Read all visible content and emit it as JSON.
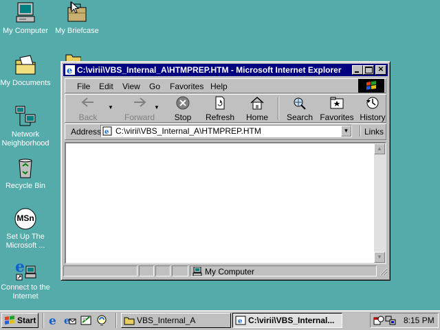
{
  "desktop": {
    "icons": [
      {
        "label_line1": "My Computer",
        "label_line2": ""
      },
      {
        "label_line1": "My Briefcase",
        "label_line2": ""
      },
      {
        "label_line1": "My Documents",
        "label_line2": ""
      },
      {
        "label_line1": "Network",
        "label_line2": "Neighborhood"
      },
      {
        "label_line1": "Recycle Bin",
        "label_line2": ""
      },
      {
        "label_line1": "Set Up The",
        "label_line2": "Microsoft ..."
      },
      {
        "label_line1": "Connect to the",
        "label_line2": "Internet"
      }
    ],
    "msn_text": "MSn"
  },
  "window": {
    "title": "C:\\virii\\VBS_Internal_A\\HTMPREP.HTM - Microsoft Internet Explorer",
    "menu": [
      "File",
      "Edit",
      "View",
      "Go",
      "Favorites",
      "Help"
    ],
    "toolbar": {
      "back": "Back",
      "forward": "Forward",
      "stop": "Stop",
      "refresh": "Refresh",
      "home": "Home",
      "search": "Search",
      "favorites": "Favorites",
      "history": "History"
    },
    "address_label": "Address",
    "address_value": "C:\\virii\\VBS_Internal_A\\HTMPREP.HTM",
    "links_label": "Links",
    "status_zone": "My Computer"
  },
  "taskbar": {
    "start_label": "Start",
    "tasks": [
      {
        "label": "VBS_Internal_A"
      },
      {
        "label": "C:\\virii\\VBS_Internal..."
      }
    ],
    "clock": "8:15 PM"
  },
  "colors": {
    "desktop": "#55aaaa",
    "titlebar": "#000080",
    "face": "#c0c0c0"
  }
}
